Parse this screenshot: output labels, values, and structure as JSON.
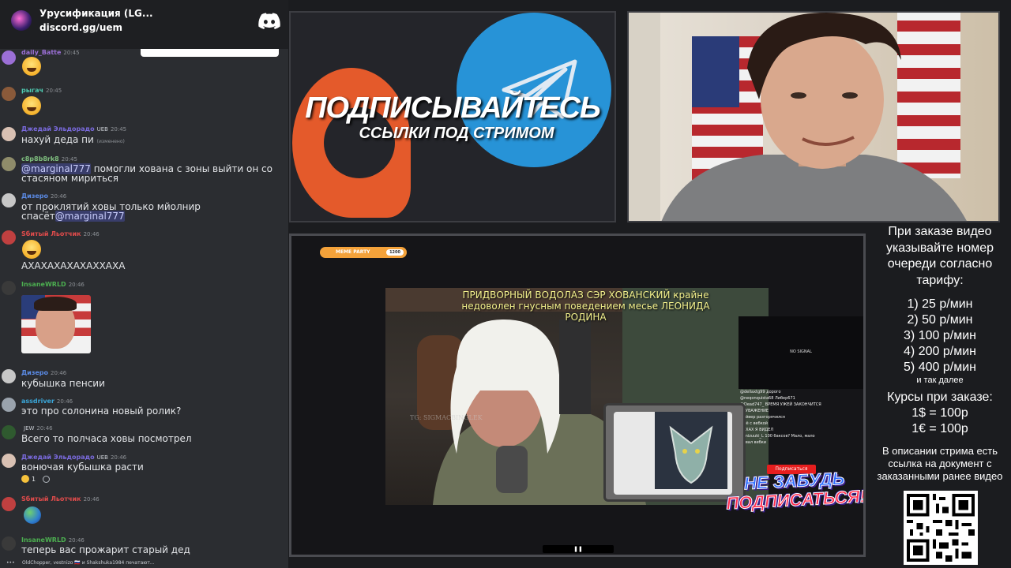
{
  "server": {
    "name": "Урусификация (LG...",
    "invite": "discord.gg/uem"
  },
  "messages": [
    {
      "user": "daily_Batte",
      "color": "#9b6fd6",
      "badge": "",
      "time": "20:45",
      "text": "",
      "emoji": "grin-emoji"
    },
    {
      "user": "рыгач",
      "color": "#4ec9b0",
      "badge": "",
      "time": "20:45",
      "text": "",
      "emoji": "laughing-emoji"
    },
    {
      "user": "Джедай Эльдорадо",
      "color": "#7b6be0",
      "badge": "UEB",
      "time": "20:45",
      "text": "нахуй деда пи",
      "edited": "(изменено)"
    },
    {
      "user": "c8p8b8rk8",
      "color": "#7fbf7f",
      "badge": "",
      "time": "20:45",
      "mention": "@marginal777",
      "text": " помогли хована с зоны выйти он со стасяном мириться"
    },
    {
      "user": "Дизеро",
      "color": "#5b8be6",
      "badge": "",
      "time": "20:46",
      "text": "от проклятий ховы только мйолнир спасёт",
      "mention_after": "@marginal777"
    },
    {
      "user": "Sбитый Льотчик",
      "color": "#e04b4b",
      "badge": "",
      "time": "20:46",
      "text": "АХАХАХАХАХАХХАХА",
      "emoji": "laughing-emoji"
    },
    {
      "user": "InsaneWRLD",
      "color": "#4caf50",
      "badge": "",
      "time": "20:46",
      "text": ""
    },
    {
      "user": "Дизеро",
      "color": "#5b8be6",
      "badge": "",
      "time": "20:46",
      "text": "кубышка пенсии"
    },
    {
      "user": "assdriver",
      "color": "#3ba7d9",
      "badge": "",
      "time": "20:46",
      "text": "это про солонина новый ролик?"
    },
    {
      "user": "",
      "color": "#c9cdd3",
      "badge": "JEW",
      "time": "20:46",
      "text": "Всего то полчаса ховы посмотрел"
    },
    {
      "user": "Джедай Эльдорадо",
      "color": "#7b6be0",
      "badge": "UEB",
      "time": "20:46",
      "text": "вонючая кубышка расти",
      "reaction": "1"
    },
    {
      "user": "Sбитый Льотчик",
      "color": "#e04b4b",
      "badge": "",
      "time": "20:46",
      "text": ""
    },
    {
      "user": "InsaneWRLD",
      "color": "#4caf50",
      "badge": "",
      "time": "20:46",
      "text": "теперь вас прожарит старый дед"
    }
  ],
  "typing": "OldChopper, vestnizo 🇷🇺 и Shakshuka1984 печатают...",
  "promo": {
    "title": "ПОДПИСЫВАЙТЕСЬ",
    "subtitle": "ССЫЛКИ ПОД СТРИМОМ"
  },
  "video": {
    "meme_badge": "MEME PARTY",
    "meme_score": "1200",
    "caption": "ПРИДВОРНЫЙ ВОДОЛАЗ СЭР ХОВАНСКИЙ крайне недоволен гнусным поведением месье ЛЕОНИДА РОДИНА",
    "watermark": "TG: SIGMACBINGLEK",
    "no_signal": "NO SIGNAL",
    "subscribe_button": "Подписаться",
    "banner_line1": "НЕ ЗАБУДЬ",
    "banner_line2": "ПОДПИСАТЬСЯ!",
    "overlay_chat": [
      "@dellaxtg99 дорого",
      "@neqonquista68 Либер671",
      "@Dead747_ ВРЕМЯ УЖЕЙ ЗАКОНЧИТСЯ",
      "НЕУВАЖЕНИЕ",
      "Дайвер разгорячился",
      "а чё с вебкой",
      "ПАХАХ Я ВИДЕЛ",
      "@mizuuki_L 100 баксов? Мало, мало",
      "Отвал вебки"
    ]
  },
  "info": {
    "order_text": "При заказе видео указывайте номер очереди согласно тарифу:",
    "tariffs": [
      "1) 25 р/мин",
      "2) 50 р/мин",
      "3) 100 р/мин",
      "4) 200 р/мин",
      "5) 400 р/мин"
    ],
    "tariffs_note": "и так далее",
    "courses_title": "Курсы при заказе:",
    "rate_usd": "1$ = 100р",
    "rate_eur": "1€ = 100р",
    "description": "В описании стрима есть ссылка на документ с заказанными ранее видео"
  },
  "colors": {
    "discord_bg": "#2b2d31",
    "server_bar": "#1e1f22",
    "telegram_blue": "#2793d7",
    "boosty_orange": "#e45a2b",
    "caption_yellow": "#f2f08c"
  }
}
